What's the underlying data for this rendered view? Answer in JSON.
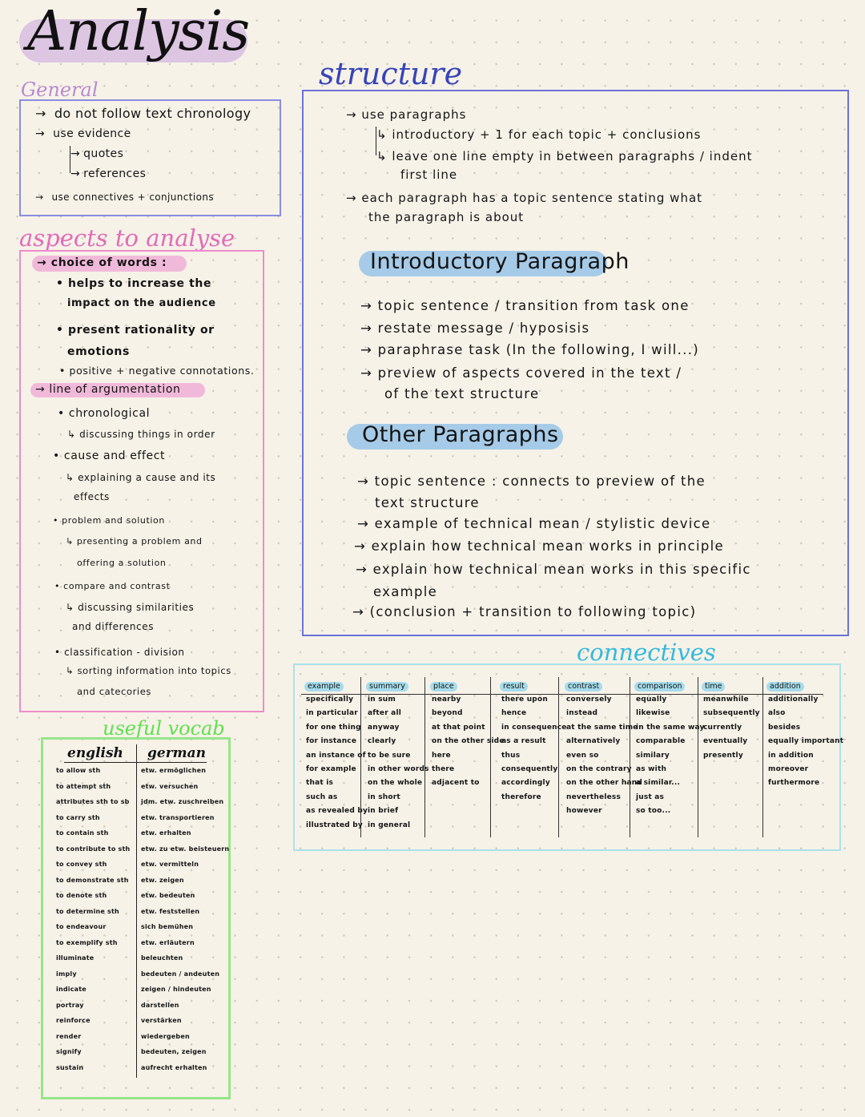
{
  "title": "Analysis",
  "general": {
    "label": "General",
    "items": [
      {
        "arrow": "→",
        "text": "do not follow text chronology"
      },
      {
        "arrow": "→",
        "text": "use evidence"
      },
      {
        "arrow": "↳",
        "text": "quotes"
      },
      {
        "arrow": "↳",
        "text": "references"
      },
      {
        "arrow": "→",
        "text": "use connectives + conjunctions"
      }
    ]
  },
  "aspects": {
    "label": "aspects to analyse",
    "choice_heading": "→ choice of words :",
    "choice_points": [
      "• helps to increase the",
      "impact on the audience",
      "• present rationality or",
      "emotions",
      "• positive + negative connotations."
    ],
    "argument_heading": "→ line of argumentation",
    "argument_points": [
      "• chronological",
      "↳ discussing things in order",
      "• cause and effect",
      "↳ explaining a cause and its",
      "effects",
      "• problem and solution",
      "↳ presenting a problem and",
      "offering a solution",
      "• compare and contrast",
      "↳ discussing similarities",
      "and differences",
      "• classification - division",
      "↳ sorting information into topics",
      "and catecories"
    ]
  },
  "structure": {
    "label": "structure",
    "items": [
      "→ use paragraphs",
      "↳ introductory + 1 for each topic + conclusions",
      "↳ leave one line empty in between paragraphs / indent",
      "first line",
      "→ each paragraph has a topic sentence stating what",
      "the paragraph is about"
    ],
    "intro": {
      "heading": "Introductory Paragraph",
      "items": [
        "→ topic sentence / transition from task one",
        "→ restate message / hyposisis",
        "→ paraphrase task (In the following, I will...)",
        "→ preview of aspects covered in the text /",
        "of the text structure"
      ]
    },
    "other": {
      "heading": "Other Paragraphs",
      "items": [
        "→ topic sentence : connects to preview of the",
        "text structure",
        "→ example of technical mean / stylistic device",
        "→ explain how technical mean works in principle",
        "→ explain how technical mean works in this specific",
        "example",
        "→ (conclusion + transition to following topic)"
      ]
    }
  },
  "connectives": {
    "label": "connectives",
    "columns": [
      {
        "heading": "example",
        "items": [
          "specifically",
          "in particular",
          "for one thing",
          "for instance",
          "an instance of",
          "for example",
          "that is",
          "such as",
          "as revealed by",
          "illustrated by"
        ]
      },
      {
        "heading": "summary",
        "items": [
          "in sum",
          "after all",
          "anyway",
          "clearly",
          "to be sure",
          "in other words",
          "on the whole",
          "in short",
          "in brief",
          "in general"
        ]
      },
      {
        "heading": "place",
        "items": [
          "nearby",
          "beyond",
          "at that point",
          "on the other side",
          "here",
          "there",
          "adjacent to"
        ]
      },
      {
        "heading": "result",
        "items": [
          "there upon",
          "hence",
          "in consequence",
          "as a result",
          "thus",
          "consequently",
          "accordingly",
          "therefore"
        ]
      },
      {
        "heading": "contrast",
        "items": [
          "conversely",
          "instead",
          "at the same time",
          "alternatively",
          "even so",
          "on the contrary",
          "on the other hand",
          "nevertheless",
          "however"
        ]
      },
      {
        "heading": "comparison",
        "items": [
          "equally",
          "likewise",
          "in the same way",
          "comparable",
          "similary",
          "as with",
          "a similar...",
          "just as",
          "so too..."
        ]
      },
      {
        "heading": "time",
        "items": [
          "meanwhile",
          "subsequently",
          "currently",
          "eventually",
          "presently"
        ]
      },
      {
        "heading": "addition",
        "items": [
          "additionally",
          "also",
          "besides",
          "equally important",
          "in addition",
          "moreover",
          "furthermore"
        ]
      }
    ]
  },
  "vocab": {
    "label": "useful vocab",
    "headers": {
      "english": "english",
      "german": "german"
    },
    "rows": [
      {
        "en": "to allow sth",
        "de": "etw. ermöglichen"
      },
      {
        "en": "to attempt sth",
        "de": "etw. versuchen"
      },
      {
        "en": "attributes sth to sb",
        "de": "jdm. etw. zuschreiben"
      },
      {
        "en": "to carry sth",
        "de": "etw. transportieren"
      },
      {
        "en": "to contain sth",
        "de": "etw. erhalten"
      },
      {
        "en": "to contribute to sth",
        "de": "etw. zu etw. beisteuern"
      },
      {
        "en": "to convey sth",
        "de": "etw. vermitteln"
      },
      {
        "en": "to demonstrate sth",
        "de": "etw. zeigen"
      },
      {
        "en": "to denote sth",
        "de": "etw. bedeuten"
      },
      {
        "en": "to determine sth",
        "de": "etw. feststellen"
      },
      {
        "en": "to endeavour",
        "de": "sich bemühen"
      },
      {
        "en": "to exemplify sth",
        "de": "etw. erläutern"
      },
      {
        "en": "illuminate",
        "de": "beleuchten"
      },
      {
        "en": "imply",
        "de": "bedeuten / andeuten"
      },
      {
        "en": "indicate",
        "de": "zeigen / hindeuten"
      },
      {
        "en": "portray",
        "de": "darstellen"
      },
      {
        "en": "reinforce",
        "de": "verstärken"
      },
      {
        "en": "render",
        "de": "wiedergeben"
      },
      {
        "en": "signify",
        "de": "bedeuten, zeigen"
      },
      {
        "en": "sustain",
        "de": "aufrecht erhalten"
      }
    ]
  }
}
